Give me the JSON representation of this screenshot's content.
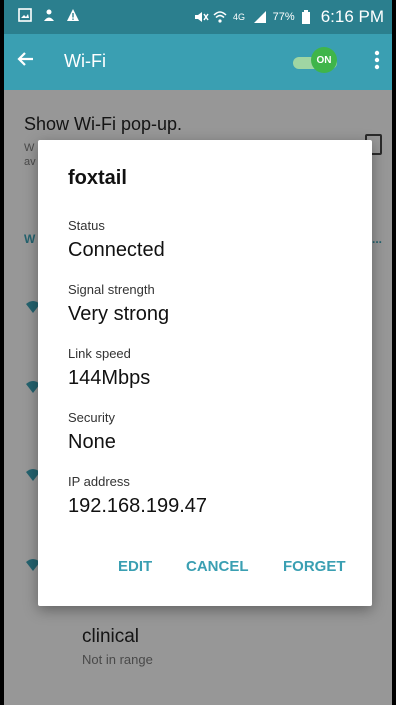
{
  "status_bar": {
    "battery_percent": "77%",
    "time": "6:16 PM"
  },
  "toolbar": {
    "title": "Wi-Fi",
    "toggle_label": "ON"
  },
  "background": {
    "popup_setting_title": "Show Wi-Fi pop-up.",
    "popup_setting_sub": "W",
    "popup_setting_sub2": "av",
    "section_header": "W",
    "section_header_end": "...",
    "network_item": {
      "name": "clinical",
      "status": "Not in range"
    }
  },
  "dialog": {
    "title": "foxtail",
    "fields": [
      {
        "label": "Status",
        "value": "Connected"
      },
      {
        "label": "Signal strength",
        "value": "Very strong"
      },
      {
        "label": "Link speed",
        "value": "144Mbps"
      },
      {
        "label": "Security",
        "value": "None"
      },
      {
        "label": "IP address",
        "value": "192.168.199.47"
      }
    ],
    "actions": {
      "edit": "EDIT",
      "cancel": "CANCEL",
      "forget": "FORGET"
    }
  },
  "colors": {
    "status_bar": "#2b7f8e",
    "toolbar": "#3a9fb2",
    "accent": "#3a9fb2",
    "toggle_on": "#3fb54a"
  },
  "icons": [
    "image-icon",
    "person-icon",
    "warning-icon",
    "mute-icon",
    "wifi-icon",
    "4g-lte-icon",
    "signal-icon",
    "battery-icon",
    "back-arrow-icon",
    "overflow-menu-icon",
    "wifi-signal-icon"
  ]
}
